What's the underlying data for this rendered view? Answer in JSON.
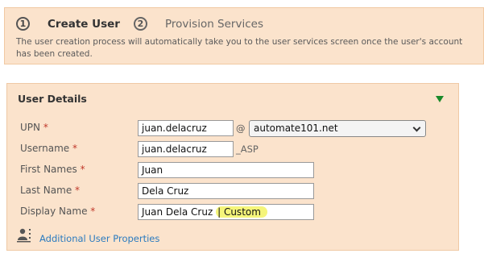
{
  "wizard": {
    "steps": [
      {
        "number": "1",
        "label": "Create User"
      },
      {
        "number": "2",
        "label": "Provision Services"
      }
    ],
    "description": "The user creation process will automatically take you to the user services screen once the user's account has been created."
  },
  "panel": {
    "title": "User Details",
    "fields": {
      "upn": {
        "label": "UPN",
        "value": "juan.delacruz",
        "at": "@",
        "domain": "automate101.net"
      },
      "username": {
        "label": "Username",
        "value": "juan.delacruz",
        "suffix": "_ASP"
      },
      "first_names": {
        "label": "First Names",
        "value": "Juan"
      },
      "last_name": {
        "label": "Last Name",
        "value": "Dela Cruz"
      },
      "display_name": {
        "label": "Display Name",
        "value": "Juan Dela Cruz",
        "highlighted": "| Custom"
      }
    },
    "required_marker": "*",
    "additional_link": "Additional User Properties"
  },
  "colors": {
    "panel_bg": "#fbe3cc",
    "link": "#2b7bbf",
    "required": "#c0392b",
    "collapse_arrow": "#1a8a2a",
    "highlight": "#f5f57a"
  }
}
